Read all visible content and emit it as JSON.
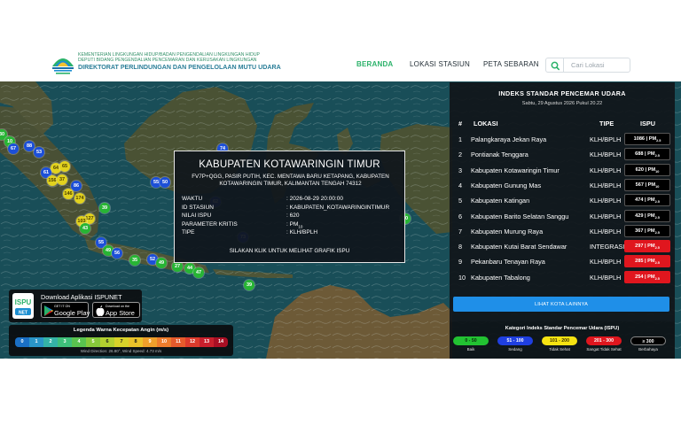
{
  "header": {
    "org_line1": "KEMENTERIAN LINGKUNGAN HIDUP/BADAN PENGENDALIAN LINGKUNGAN HIDUP",
    "org_line2": "DEPUTI BIDANG PENGENDALIAN PENCEMARAN DAN KERUSAKAN LINGKUNGAN",
    "org_line3": "DIREKTORAT PERLINDUNGAN DAN PENGELOLAAN MUTU UDARA",
    "nav": [
      {
        "label": "BERANDA",
        "active": true
      },
      {
        "label": "LOKASI STASIUN",
        "active": false
      },
      {
        "label": "PETA SEBARAN",
        "active": false
      }
    ],
    "search_placeholder": "Cari Lokasi"
  },
  "colors": {
    "brand_green": "#2bb26a",
    "map_sea": "#194e58",
    "land": "#495035",
    "good": "#22b532",
    "moderate": "#1f4fd8",
    "unhealthy": "#f6e312",
    "very_unhealthy": "#e0161e",
    "dangerous": "#000000"
  },
  "map": {
    "markers": [
      {
        "v": "30",
        "c": "green"
      },
      {
        "v": "10",
        "c": "green"
      },
      {
        "v": "67",
        "c": "blue"
      },
      {
        "v": "88",
        "c": "blue"
      },
      {
        "v": "53",
        "c": "blue"
      },
      {
        "v": "64",
        "c": "yellow"
      },
      {
        "v": "65",
        "c": "yellow"
      },
      {
        "v": "61",
        "c": "blue"
      },
      {
        "v": "156",
        "c": "yellow"
      },
      {
        "v": "37",
        "c": "yellow"
      },
      {
        "v": "86",
        "c": "blue"
      },
      {
        "v": "146",
        "c": "yellow"
      },
      {
        "v": "174",
        "c": "yellow"
      },
      {
        "v": "39",
        "c": "green"
      },
      {
        "v": "127",
        "c": "yellow"
      },
      {
        "v": "103",
        "c": "yellow"
      },
      {
        "v": "43",
        "c": "green"
      },
      {
        "v": "55",
        "c": "blue"
      },
      {
        "v": "49",
        "c": "green"
      },
      {
        "v": "56",
        "c": "blue"
      },
      {
        "v": "35",
        "c": "green"
      },
      {
        "v": "52",
        "c": "blue"
      },
      {
        "v": "49",
        "c": "green"
      },
      {
        "v": "27",
        "c": "green"
      },
      {
        "v": "44",
        "c": "green"
      },
      {
        "v": "47",
        "c": "green"
      },
      {
        "v": "39",
        "c": "green"
      },
      {
        "v": "55",
        "c": "blue"
      },
      {
        "v": "50",
        "c": "blue"
      },
      {
        "v": "74",
        "c": "blue"
      },
      {
        "v": "73",
        "c": "blue"
      },
      {
        "v": "50",
        "c": "green"
      },
      {
        "v": "62",
        "c": "blue"
      }
    ]
  },
  "popup": {
    "title": "KABUPATEN KOTAWARINGIN TIMUR",
    "address_line1": "FV7P+QGG, PASIR PUTIH, KEC. MENTAWA BARU KETAPANG, KABUPATEN",
    "address_line2": "KOTAWARINGIN TIMUR, KALIMANTAN TENGAH 74312",
    "fields": [
      {
        "key": "WAKTU",
        "value": ": 2026-08-29 20:00:00"
      },
      {
        "key": "ID STASIUN",
        "value": ": KABUPATEN_KOTAWARINGINTIMUR"
      },
      {
        "key": "NILAI ISPU",
        "value": ": 620"
      },
      {
        "key": "PARAMETER KRITIS",
        "value": ": PM",
        "sub": "10"
      },
      {
        "key": "TIPE",
        "value": ": KLH/BPLH"
      }
    ],
    "cta": "SILAKAN KLIK UNTUK MELIHAT GRAFIK ISPU"
  },
  "ranking": {
    "title": "INDEKS STANDAR PENCEMAR UDARA",
    "datetime": "Sabtu, 29 Agustus 2026 Pukul 20.22",
    "headers": {
      "no": "#",
      "loc": "LOKASI",
      "type": "TIPE",
      "ispu": "ISPU"
    },
    "rows": [
      {
        "no": "1",
        "loc": "Palangkaraya Jekan Raya",
        "type": "KLH/BPLH",
        "val": "1086 | PM",
        "sub": "2.5",
        "color": "black"
      },
      {
        "no": "2",
        "loc": "Pontianak Tenggara",
        "type": "KLH/BPLH",
        "val": "688 | PM",
        "sub": "2.5",
        "color": "black"
      },
      {
        "no": "3",
        "loc": "Kabupaten Kotawaringin Timur",
        "type": "KLH/BPLH",
        "val": "620 | PM",
        "sub": "10",
        "color": "black"
      },
      {
        "no": "4",
        "loc": "Kabupaten Gunung Mas",
        "type": "KLH/BPLH",
        "val": "567 | PM",
        "sub": "10",
        "color": "black"
      },
      {
        "no": "5",
        "loc": "Kabupaten Katingan",
        "type": "KLH/BPLH",
        "val": "474 | PM",
        "sub": "2.5",
        "color": "black"
      },
      {
        "no": "6",
        "loc": "Kabupaten Barito Selatan Sanggu",
        "type": "KLH/BPLH",
        "val": "429 | PM",
        "sub": "2.5",
        "color": "black"
      },
      {
        "no": "7",
        "loc": "Kabupaten Murung Raya",
        "type": "KLH/BPLH",
        "val": "367 | PM",
        "sub": "2.5",
        "color": "black"
      },
      {
        "no": "8",
        "loc": "Kabupaten Kutai Barat Sendawar",
        "type": "INTEGRASI",
        "val": "297 | PM",
        "sub": "2.5",
        "color": "red"
      },
      {
        "no": "9",
        "loc": "Pekanbaru Tenayan Raya",
        "type": "KLH/BPLH",
        "val": "285 | PM",
        "sub": "2.5",
        "color": "red"
      },
      {
        "no": "10",
        "loc": "Kabupaten Tabalong",
        "type": "KLH/BPLH",
        "val": "254 | PM",
        "sub": "2.5",
        "color": "red"
      }
    ],
    "more_button": "LIHAT KOTA LAINNYA"
  },
  "ispu_legend": {
    "title": "Kategori Indeks Standar Pencemar Udara (ISPU)",
    "items": [
      {
        "range": "0 - 50",
        "label": "Baik",
        "bg": "#22c232",
        "fg": "#0b2c0b"
      },
      {
        "range": "51 - 100",
        "label": "Sedang",
        "bg": "#1f3fe0",
        "fg": "#ffffff"
      },
      {
        "range": "101 - 200",
        "label": "Tidak Sehat",
        "bg": "#f6e312",
        "fg": "#3a3000"
      },
      {
        "range": "201 - 300",
        "label": "Sangat Tidak Sehat",
        "bg": "#e0161e",
        "fg": "#ffffff"
      },
      {
        "range": "≥ 300",
        "label": "Berbahaya",
        "bg": "#000000",
        "fg": "#ffffff"
      }
    ]
  },
  "download": {
    "title": "Download Aplikasi ISPUNET",
    "logo_text": "ISPU",
    "logo_sub": "NET",
    "google": {
      "small": "GET IT ON",
      "big": "Google Play"
    },
    "apple": {
      "small": "Download on the",
      "big": "App Store"
    }
  },
  "wind": {
    "title": "Legenda Warna Kecepatan Angin (m/s)",
    "scale": [
      {
        "v": "0",
        "bg": "#1a6fc4",
        "fg": "#ffffff"
      },
      {
        "v": "1",
        "bg": "#2a95c7",
        "fg": "#ffffff"
      },
      {
        "v": "2",
        "bg": "#34b2a6",
        "fg": "#ffffff"
      },
      {
        "v": "3",
        "bg": "#3ebf7a",
        "fg": "#ffffff"
      },
      {
        "v": "4",
        "bg": "#59c34f",
        "fg": "#ffffff"
      },
      {
        "v": "5",
        "bg": "#86c93b",
        "fg": "#ffffff"
      },
      {
        "v": "6",
        "bg": "#b2cf30",
        "fg": "#1a1a1a"
      },
      {
        "v": "7",
        "bg": "#d7d22a",
        "fg": "#1a1a1a"
      },
      {
        "v": "8",
        "bg": "#e9c22a",
        "fg": "#1a1a1a"
      },
      {
        "v": "9",
        "bg": "#ee9f2b",
        "fg": "#ffffff"
      },
      {
        "v": "10",
        "bg": "#ec7c2c",
        "fg": "#ffffff"
      },
      {
        "v": "11",
        "bg": "#e65a2c",
        "fg": "#ffffff"
      },
      {
        "v": "12",
        "bg": "#dc3a2c",
        "fg": "#ffffff"
      },
      {
        "v": "13",
        "bg": "#c81f2c",
        "fg": "#ffffff"
      },
      {
        "v": "14",
        "bg": "#a90f24",
        "fg": "#ffffff"
      }
    ],
    "info": "Wind Direction: 26.80°, Wind Speed: 4.73 m/s"
  }
}
